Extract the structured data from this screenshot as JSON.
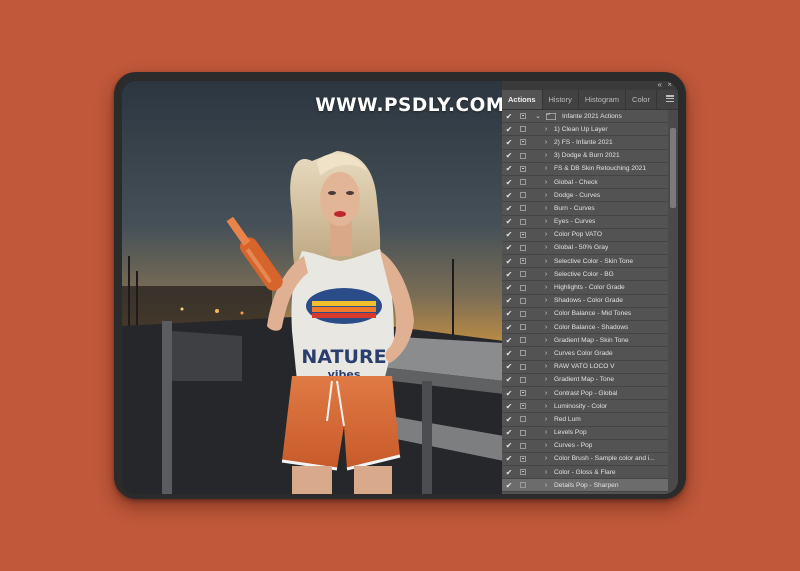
{
  "watermark": "WWW.PSDLY.COM",
  "colors": {
    "background": "#c1583a",
    "device": "#2b2b2b",
    "panel": "#535353",
    "tab_bar": "#424242"
  },
  "panel": {
    "tabs": [
      "Actions",
      "History",
      "Histogram",
      "Color"
    ],
    "active_tab": "Actions",
    "set_name": "Infante 2021 Actions",
    "actions": [
      {
        "label": "1) Clean Up Layer",
        "dialog": false
      },
      {
        "label": "2) FS - Infante 2021",
        "dialog": true
      },
      {
        "label": "3) Dodge & Burn 2021",
        "dialog": false
      },
      {
        "label": "FS & DB Skin Retouching 2021",
        "dialog": true
      },
      {
        "label": "Global - Check",
        "dialog": false
      },
      {
        "label": "Dodge - Curves",
        "dialog": false
      },
      {
        "label": "Burn - Curves",
        "dialog": false
      },
      {
        "label": "Eyes - Curves",
        "dialog": false
      },
      {
        "label": "Color Pop VATO",
        "dialog": true
      },
      {
        "label": "Global - 50% Gray",
        "dialog": false
      },
      {
        "label": "Selective Color - Skin Tone",
        "dialog": true
      },
      {
        "label": "Selective Color - BG",
        "dialog": false
      },
      {
        "label": "Highlights - Color Grade",
        "dialog": false
      },
      {
        "label": "Shadows - Color Grade",
        "dialog": false
      },
      {
        "label": "Color Balance - Mid Tones",
        "dialog": false
      },
      {
        "label": "Color Balance - Shadows",
        "dialog": false
      },
      {
        "label": "Gradient Map - Skin Tone",
        "dialog": false
      },
      {
        "label": "Curves Color Grade",
        "dialog": false
      },
      {
        "label": "RAW VATO LOCO V",
        "dialog": false
      },
      {
        "label": "Gradient Map - Tone",
        "dialog": false
      },
      {
        "label": "Contrast Pop - Global",
        "dialog": true
      },
      {
        "label": "Luminosity - Color",
        "dialog": true
      },
      {
        "label": "Red Lum",
        "dialog": false
      },
      {
        "label": "Levels Pop",
        "dialog": false
      },
      {
        "label": "Curves - Pop",
        "dialog": false
      },
      {
        "label": "Color Brush - Sample color and i...",
        "dialog": true
      },
      {
        "label": "Color - Gloss & Flare",
        "dialog": true
      },
      {
        "label": "Details Pop - Sharpen",
        "dialog": false,
        "selected": true
      }
    ]
  },
  "photo": {
    "shirt_text_line1": "NATURE",
    "shirt_text_line2": "vibes"
  }
}
